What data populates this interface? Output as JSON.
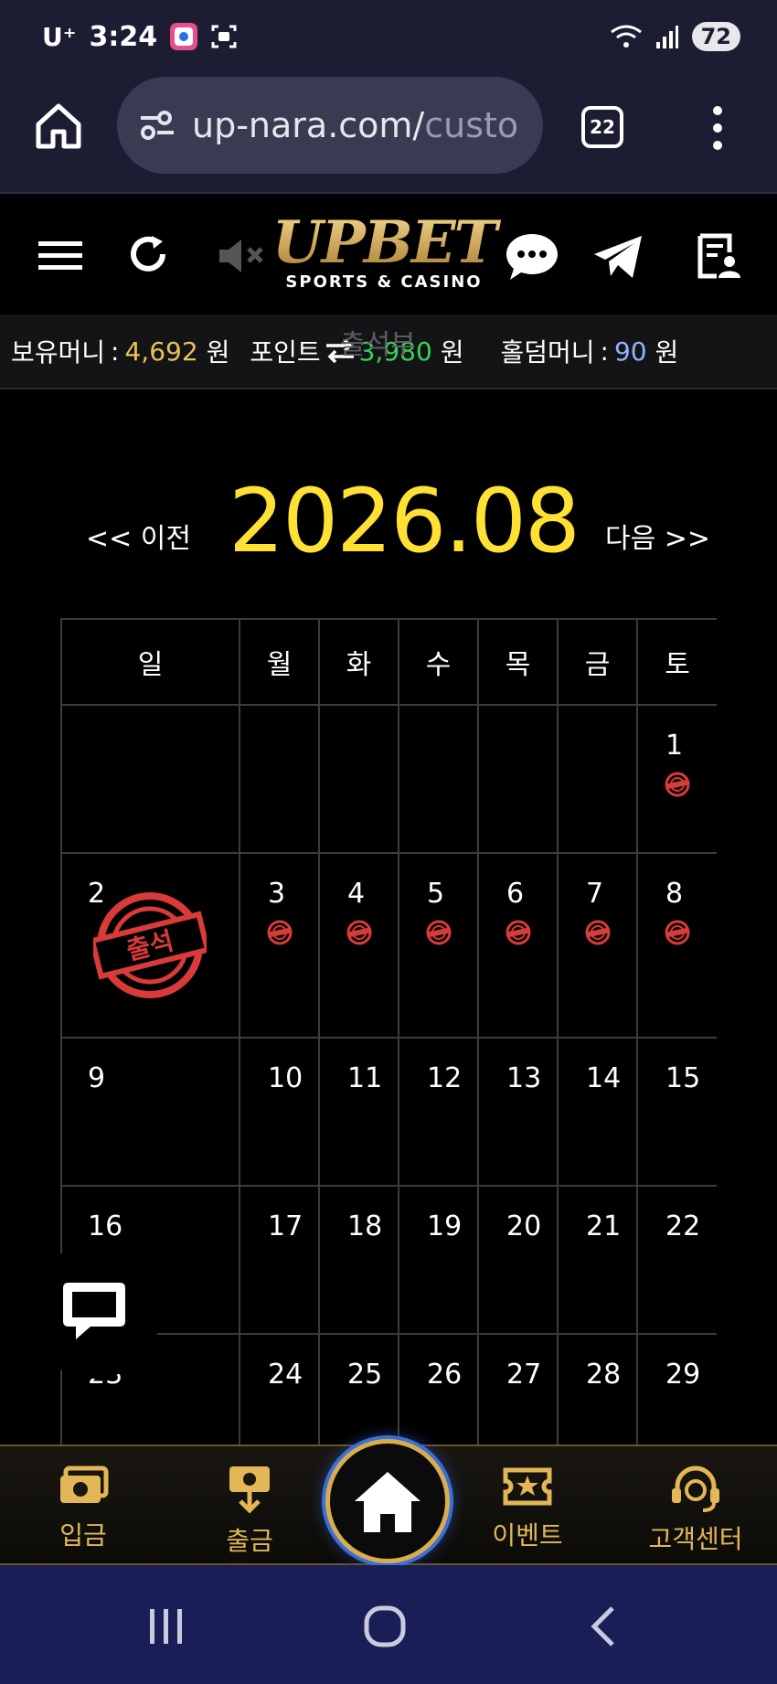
{
  "status_bar": {
    "carrier": "U⁺",
    "time": "3:24",
    "battery": "72"
  },
  "browser": {
    "url_main": "up-nara.com/",
    "url_faded": "custo",
    "tab_count": "22"
  },
  "site": {
    "logo_text": "UPBET",
    "logo_subtitle": "SPORTS & CASINO"
  },
  "money_bar": {
    "balance_label": "보유머니",
    "balance_value": "4,692",
    "balance_unit": "원",
    "point_label": "포인트",
    "point_value": "3,980",
    "point_unit": "원",
    "holdem_label": "홀덤머니",
    "holdem_value": "90",
    "holdem_unit": "원",
    "ghost_title": "출석부"
  },
  "calendar": {
    "prev_label": "<< 이전",
    "next_label": "다음 >>",
    "month": "2026.08",
    "weekdays": [
      "일",
      "월",
      "화",
      "수",
      "목",
      "금",
      "토"
    ],
    "weeks": [
      [
        "",
        "",
        "",
        "",
        "",
        "",
        "1"
      ],
      [
        "2",
        "3",
        "4",
        "5",
        "6",
        "7",
        "8"
      ],
      [
        "9",
        "10",
        "11",
        "12",
        "13",
        "14",
        "15"
      ],
      [
        "16",
        "17",
        "18",
        "19",
        "20",
        "21",
        "22"
      ],
      [
        "23",
        "24",
        "25",
        "26",
        "27",
        "28",
        "29"
      ]
    ],
    "attended_stamp_text": "출석",
    "stamp_color": "#d93a3a"
  },
  "bottom_nav": {
    "deposit": "입금",
    "withdraw": "출금",
    "event": "이벤트",
    "support": "고객센터"
  },
  "colors": {
    "gold": "#e3b757",
    "month_yellow": "#ffe033",
    "point_green": "#36d35a"
  }
}
